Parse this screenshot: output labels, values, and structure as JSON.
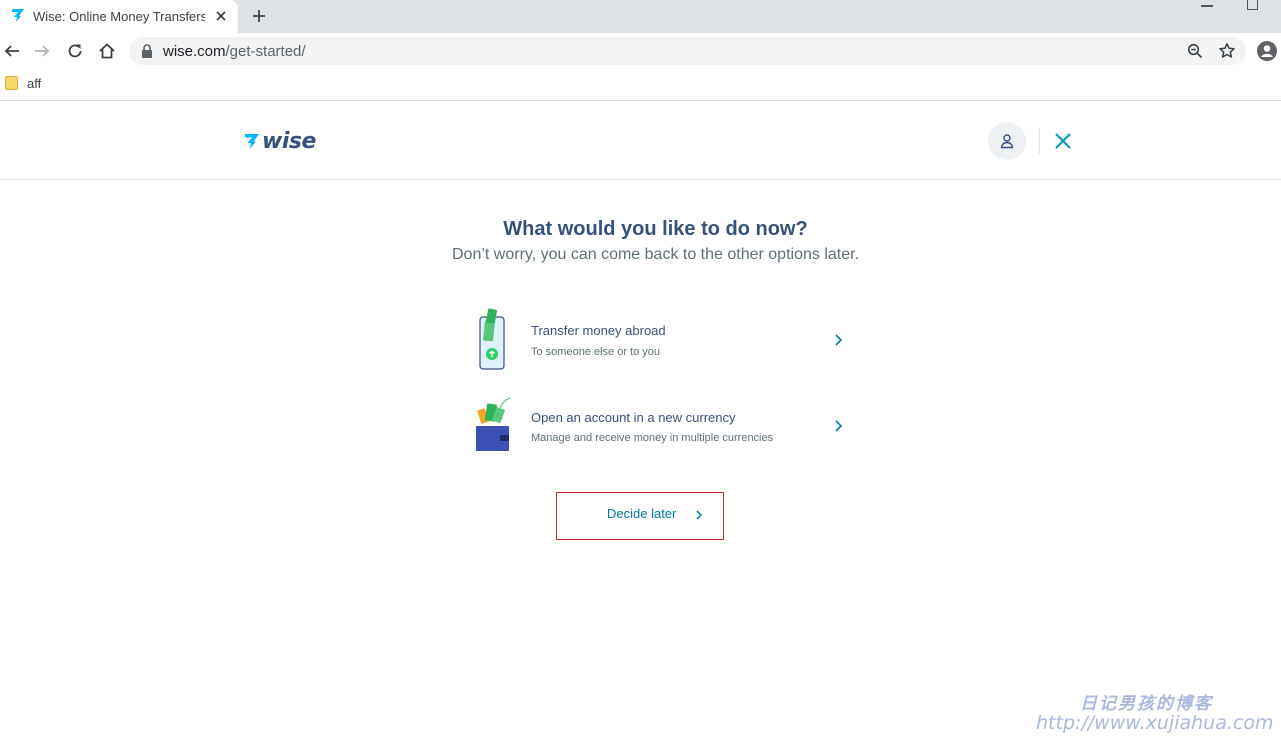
{
  "browser": {
    "tab_title": "Wise: Online Money Transfers",
    "url_host": "wise.com",
    "url_path": "/get-started/",
    "bookmarks": [
      {
        "label": "aff",
        "icon": "folder-icon"
      }
    ]
  },
  "header": {
    "logo_text": "wise",
    "account_icon": "user-icon",
    "close_icon": "close-icon"
  },
  "main": {
    "heading": "What would you like to do now?",
    "subheading": "Don’t worry, you can come back to the other options later.",
    "options": [
      {
        "title": "Transfer money abroad",
        "description": "To someone else or to you",
        "icon": "phone-money-illustration"
      },
      {
        "title": "Open an account in a new currency",
        "description": "Manage and receive money in multiple currencies",
        "icon": "wallet-illustration"
      }
    ],
    "decide_later_label": "Decide later"
  },
  "watermark": {
    "chinese": "日记男孩的博客",
    "url": "http://www.xujiahua.com"
  },
  "colors": {
    "primary_text": "#37517e",
    "secondary_text": "#5d7079",
    "link": "#0077a5",
    "highlight_border": "#d0232e",
    "brand_accent": "#00b9ff"
  }
}
